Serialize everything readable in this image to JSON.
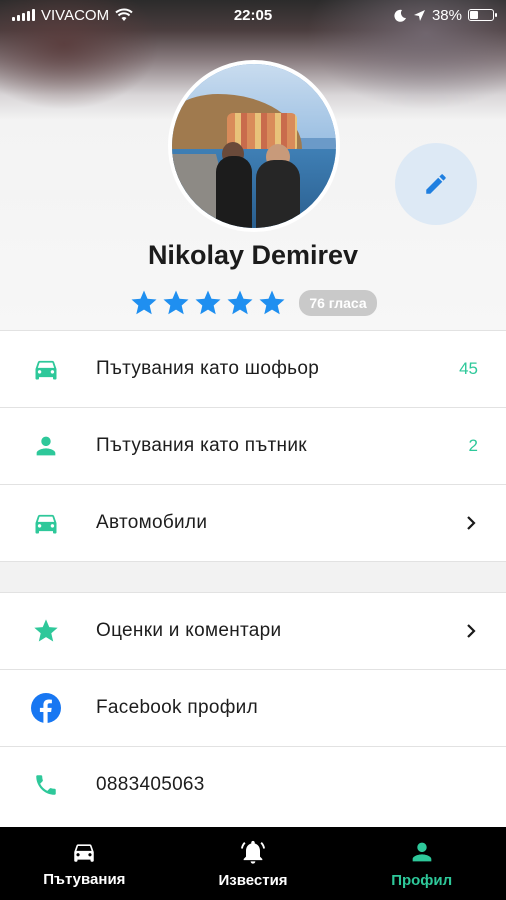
{
  "status_bar": {
    "carrier": "VIVACOM",
    "time": "22:05",
    "battery": "38%",
    "battery_level": 0.38
  },
  "profile": {
    "name": "Nikolay Demirev",
    "rating_stars": 5,
    "votes_label": "76 гласа"
  },
  "menu": {
    "driver_trips": {
      "label": "Пътувания като шофьор",
      "count": "45",
      "icon": "car-icon"
    },
    "passenger_trips": {
      "label": "Пътувания като пътник",
      "count": "2",
      "icon": "person-icon"
    },
    "cars": {
      "label": "Автомобили",
      "icon": "car-icon"
    },
    "reviews": {
      "label": "Оценки и коментари",
      "icon": "star-icon"
    },
    "facebook": {
      "label": "Facebook профил",
      "icon": "facebook-icon"
    },
    "phone": {
      "label": "0883405063",
      "icon": "phone-icon"
    }
  },
  "tabs": [
    {
      "label": "Пътувания",
      "icon": "car-icon",
      "active": false
    },
    {
      "label": "Известия",
      "icon": "bell-icon",
      "active": false
    },
    {
      "label": "Профил",
      "icon": "person-icon",
      "active": true
    }
  ],
  "colors": {
    "accent_green": "#2ec89a",
    "star_blue": "#1f8ff0",
    "facebook_blue": "#1877f2",
    "tabbar_bg": "#000000"
  }
}
